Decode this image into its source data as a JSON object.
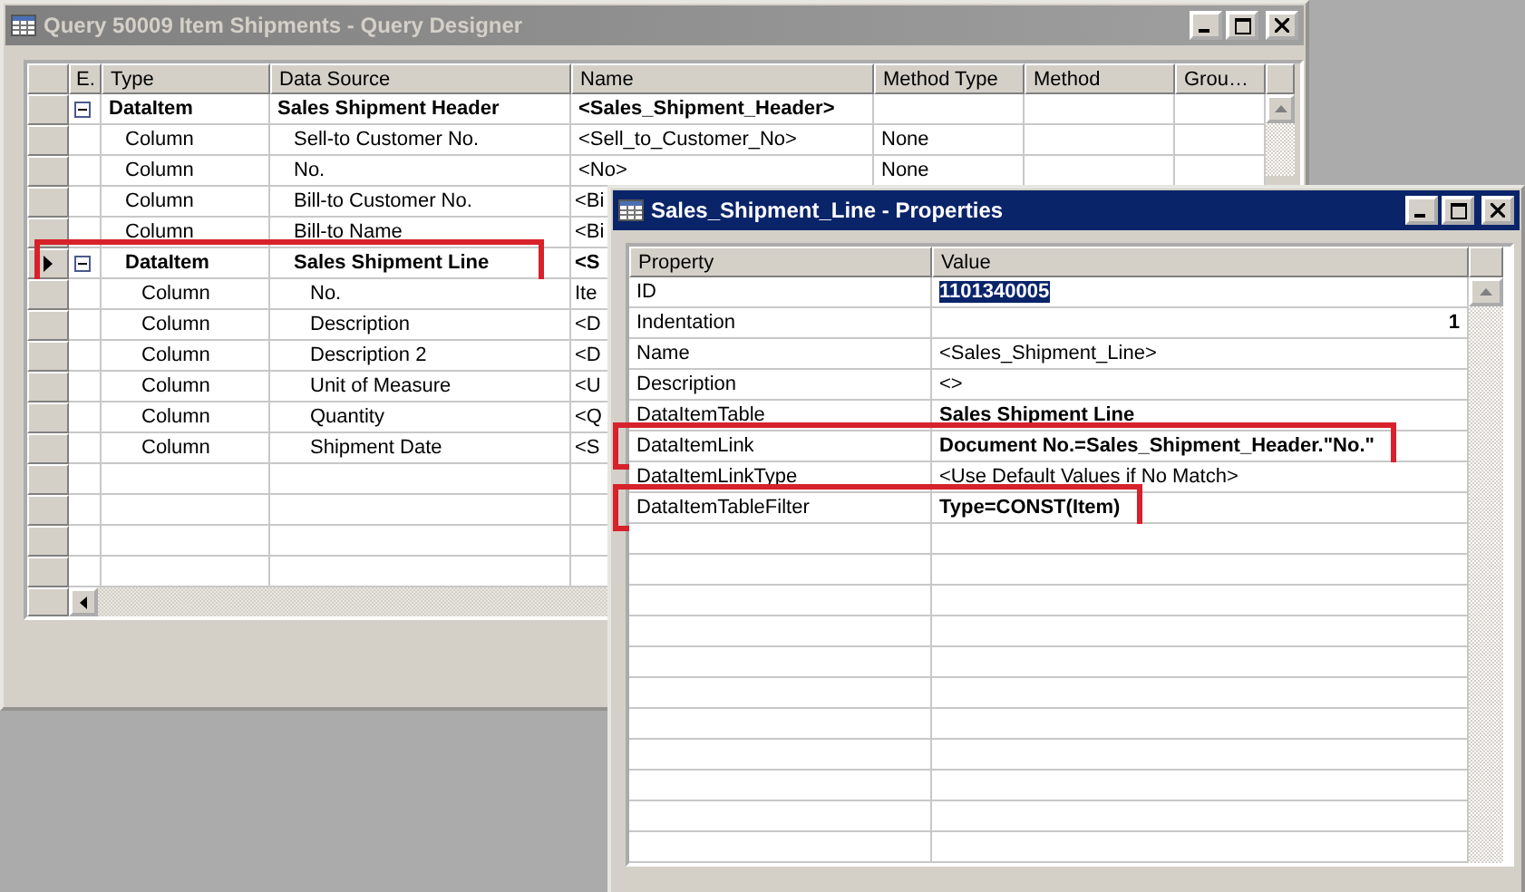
{
  "designer": {
    "title": "Query 50009 Item Shipments - Query Designer",
    "active": false,
    "columns": [
      "E.",
      "Type",
      "Data Source",
      "Name",
      "Method Type",
      "Method",
      "Grou…"
    ],
    "items": [
      {
        "kind": "dataitem",
        "type": "DataItem",
        "source": "Sales Shipment Header",
        "name": "<Sales_Shipment_Header>",
        "expanded": true,
        "current": false,
        "children": [
          {
            "kind": "column",
            "type": "Column",
            "source": "Sell-to Customer No.",
            "name": "<Sell_to_Customer_No>",
            "method_type": "None",
            "current": false
          },
          {
            "kind": "column",
            "type": "Column",
            "source": "No.",
            "name": "<No>",
            "method_type": "None",
            "current": false
          },
          {
            "kind": "column",
            "type": "Column",
            "source": "Bill-to Customer No.",
            "name": "<Bi",
            "current": false
          },
          {
            "kind": "column",
            "type": "Column",
            "source": "Bill-to Name",
            "name": "<Bi",
            "current": false
          },
          {
            "kind": "dataitem",
            "type": "DataItem",
            "source": "Sales Shipment Line",
            "name": "<S",
            "expanded": true,
            "current": true,
            "highlighted": true,
            "children": [
              {
                "kind": "column",
                "type": "Column",
                "source": "No.",
                "name": "Ite",
                "current": false
              },
              {
                "kind": "column",
                "type": "Column",
                "source": "Description",
                "name": "<D",
                "current": false
              },
              {
                "kind": "column",
                "type": "Column",
                "source": "Description 2",
                "name": "<D",
                "current": false
              },
              {
                "kind": "column",
                "type": "Column",
                "source": "Unit of Measure",
                "name": "<U",
                "current": false
              },
              {
                "kind": "column",
                "type": "Column",
                "source": "Quantity",
                "name": "<Q",
                "current": false
              },
              {
                "kind": "column",
                "type": "Column",
                "source": "Shipment Date",
                "name": "<S",
                "current": false
              }
            ]
          }
        ]
      }
    ]
  },
  "properties": {
    "title": "Sales_Shipment_Line - Properties",
    "active": true,
    "columns": [
      "Property",
      "Value"
    ],
    "rows": [
      {
        "kind": "text",
        "property": "ID",
        "value": "1101340005",
        "modified": true,
        "selected": true
      },
      {
        "kind": "number",
        "property": "Indentation",
        "value": "1",
        "modified": true,
        "selected": false
      },
      {
        "kind": "text",
        "property": "Name",
        "value": "<Sales_Shipment_Line>",
        "modified": false,
        "selected": false
      },
      {
        "kind": "text",
        "property": "Description",
        "value": "<>",
        "modified": false,
        "selected": false
      },
      {
        "kind": "text",
        "property": "DataItemTable",
        "value": "Sales Shipment Line",
        "modified": true,
        "selected": false
      },
      {
        "kind": "text",
        "property": "DataItemLink",
        "value": "Document No.=Sales_Shipment_Header.\"No.\"",
        "modified": true,
        "selected": false,
        "highlighted": true
      },
      {
        "kind": "text",
        "property": "DataItemLinkType",
        "value": "<Use Default Values if No Match>",
        "modified": false,
        "selected": false
      },
      {
        "kind": "text",
        "property": "DataItemTableFilter",
        "value": "Type=CONST(Item)",
        "modified": true,
        "selected": false,
        "highlighted": true
      }
    ]
  }
}
